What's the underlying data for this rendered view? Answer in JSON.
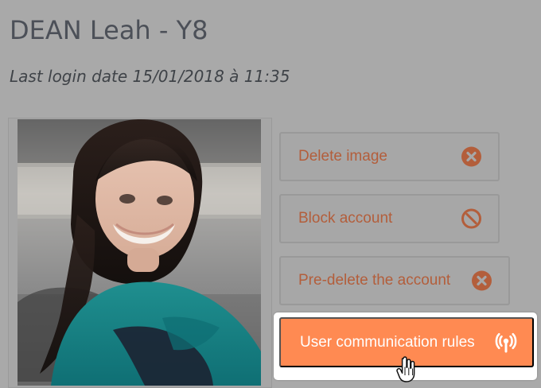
{
  "profile": {
    "title": "DEAN Leah - Y8",
    "last_login": "Last login date 15/01/2018 à 11:35"
  },
  "actions": {
    "delete_image": {
      "label": "Delete image",
      "icon": "x-circle-icon"
    },
    "block_account": {
      "label": "Block account",
      "icon": "block-icon"
    },
    "pre_delete_account": {
      "label": "Pre-delete the account",
      "icon": "x-circle-icon"
    },
    "user_communication_rules": {
      "label": "User communication rules",
      "icon": "broadcast-icon"
    }
  },
  "colors": {
    "overlay_gray": "#a9a9a9",
    "muted_accent": "#b35e3b",
    "accent": "#ff8a52",
    "accent_text": "#ffffff",
    "title_text": "#4c5058"
  },
  "pointer": {
    "icon": "hand-pointer-icon"
  }
}
